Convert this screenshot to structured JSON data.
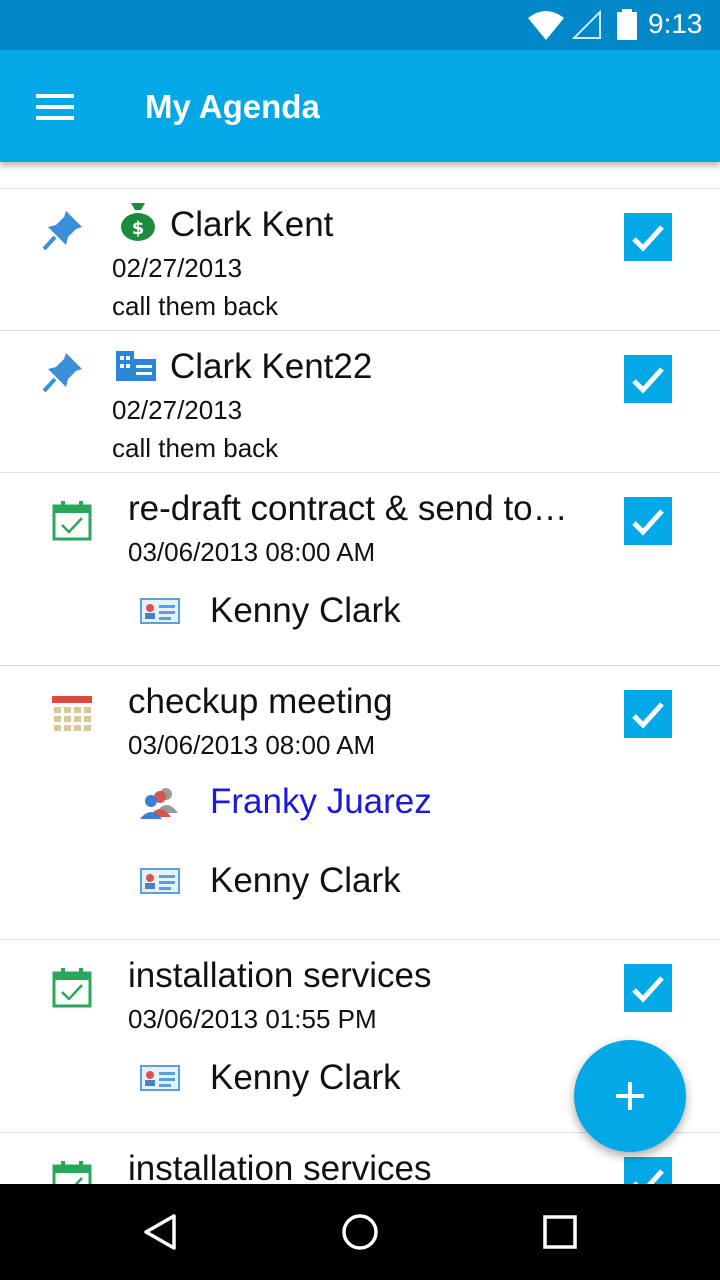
{
  "status_bar": {
    "time": "9:13"
  },
  "app_bar": {
    "title": "My Agenda"
  },
  "items": [
    {
      "kind": "opportunity",
      "title": "Clark Kent",
      "date": "02/27/2013",
      "note": "call them back",
      "checked": true
    },
    {
      "kind": "account",
      "title": "Clark Kent22",
      "date": "02/27/2013",
      "note": "call them back",
      "checked": true
    },
    {
      "kind": "task",
      "title": "re-draft contract & send to…",
      "date": "03/06/2013 08:00 AM",
      "related": [
        {
          "type": "contact",
          "name": "Kenny Clark"
        }
      ],
      "checked": true
    },
    {
      "kind": "meeting",
      "title": "checkup meeting",
      "date": "03/06/2013 08:00 AM",
      "related": [
        {
          "type": "group",
          "name": "Franky Juarez"
        },
        {
          "type": "contact",
          "name": "Kenny Clark"
        }
      ],
      "checked": true
    },
    {
      "kind": "task",
      "title": "installation services",
      "date": "03/06/2013 01:55 PM",
      "related": [
        {
          "type": "contact",
          "name": "Kenny Clark"
        }
      ],
      "checked": true
    },
    {
      "kind": "task",
      "title": "installation services",
      "checked": true
    }
  ],
  "colors": {
    "accent": "#03a9e6",
    "status_bar": "#0288c8",
    "link": "#1a1add"
  }
}
